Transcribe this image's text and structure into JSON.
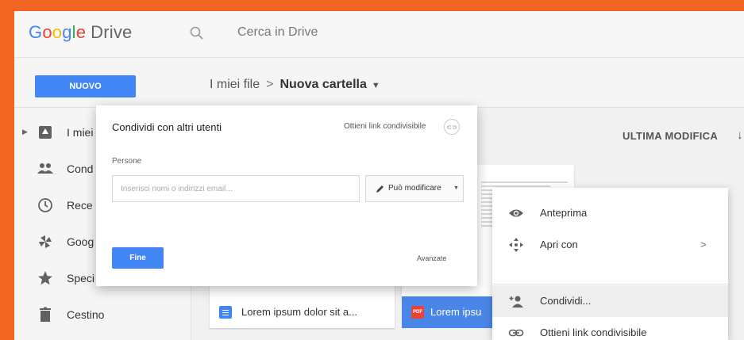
{
  "app": {
    "logo_word": "Google",
    "logo_product": "Drive",
    "search_placeholder": "Cerca in Drive"
  },
  "toolbar": {
    "new_label": "NUOVO",
    "breadcrumb_root": "I miei file",
    "breadcrumb_sep": ">",
    "breadcrumb_current": "Nuova cartella"
  },
  "sidebar": {
    "items": [
      {
        "label": "I miei",
        "icon": "drive-icon"
      },
      {
        "label": "Cond",
        "icon": "people-icon"
      },
      {
        "label": "Rece",
        "icon": "clock-icon"
      },
      {
        "label": "Goog",
        "icon": "photos-icon"
      },
      {
        "label": "Speci",
        "icon": "star-icon"
      },
      {
        "label": "Cestino",
        "icon": "trash-icon"
      }
    ]
  },
  "content": {
    "sort_label": "ULTIMA MODIFICA",
    "files": [
      {
        "name": "Lorem ipsum dolor sit a...",
        "type": "doc"
      },
      {
        "name": "Lorem ipsu",
        "type": "pdf",
        "type_label": "PDF"
      }
    ]
  },
  "share_dialog": {
    "title": "Condividi con altri utenti",
    "link_label": "Ottieni link condivisibile",
    "people_label": "Persone",
    "input_placeholder": "Inserisci nomi o indirizzi email...",
    "permission_label": "Può modificare",
    "done_label": "Fine",
    "advanced_label": "Avanzate"
  },
  "context_menu": {
    "items": [
      {
        "label": "Anteprima",
        "icon": "eye-icon"
      },
      {
        "label": "Apri con",
        "icon": "move-icon",
        "has_submenu": true
      },
      {
        "label": "Condividi...",
        "icon": "add-person-icon",
        "highlighted": true
      },
      {
        "label": "Ottieni link condivisibile",
        "icon": "link-icon"
      }
    ],
    "submenu_arrow": ">"
  },
  "colors": {
    "frame": "#f26522",
    "accent": "#4285f4",
    "selected_file": "#4a86e8",
    "pdf": "#ea4335"
  }
}
